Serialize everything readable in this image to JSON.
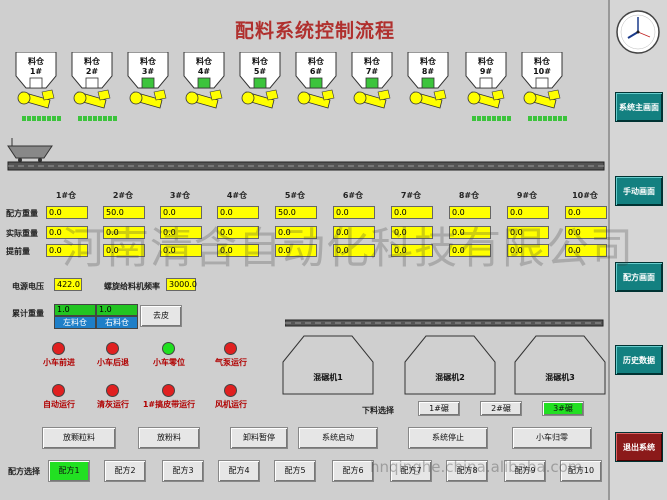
{
  "title": "配料系统控制流程",
  "hoppers": [
    {
      "line1": "料仓",
      "line2": "1#"
    },
    {
      "line1": "料仓",
      "line2": "2#"
    },
    {
      "line1": "料仓",
      "line2": "3#"
    },
    {
      "line1": "料仓",
      "line2": "4#"
    },
    {
      "line1": "料仓",
      "line2": "5#"
    },
    {
      "line1": "料仓",
      "line2": "6#"
    },
    {
      "line1": "料仓",
      "line2": "7#"
    },
    {
      "line1": "料仓",
      "line2": "8#"
    },
    {
      "line1": "料仓",
      "line2": "9#"
    },
    {
      "line1": "料仓",
      "line2": "10#"
    }
  ],
  "table": {
    "columns": [
      "1#仓",
      "2#仓",
      "3#仓",
      "4#仓",
      "5#仓",
      "6#仓",
      "7#仓",
      "8#仓",
      "9#仓",
      "10#仓"
    ],
    "rows": [
      {
        "label": "配方重量",
        "values": [
          "0.0",
          "50.0",
          "0.0",
          "0.0",
          "50.0",
          "0.0",
          "0.0",
          "0.0",
          "0.0",
          "0.0"
        ]
      },
      {
        "label": "实际重量",
        "values": [
          "0.0",
          "0.0",
          "0.0",
          "0.0",
          "0.0",
          "0.0",
          "0.0",
          "0.0",
          "0.0",
          "0.0"
        ]
      },
      {
        "label": "提前量",
        "values": [
          "0.0",
          "0.0",
          "0.0",
          "0.0",
          "0.0",
          "0.0",
          "0.0",
          "0.0",
          "0.0",
          "0.0"
        ]
      }
    ]
  },
  "voltage": {
    "label": "电源电压",
    "value": "422.0"
  },
  "screw_freq": {
    "label": "螺旋给料机频率",
    "value": "3000.0"
  },
  "cumulative": {
    "label": "累计重量",
    "left_value": "1.0",
    "right_value": "1.0",
    "left_label": "左料仓",
    "right_label": "右料仓"
  },
  "remove_tare": "去皮",
  "lamps_row1": [
    {
      "label": "小车前进",
      "color": "#e02020"
    },
    {
      "label": "小车后退",
      "color": "#e02020"
    },
    {
      "label": "小车零位",
      "color": "#20e020"
    },
    {
      "label": "气泵运行",
      "color": "#e02020"
    }
  ],
  "lamps_row2": [
    {
      "label": "自动运行",
      "color": "#e02020"
    },
    {
      "label": "清灰运行",
      "color": "#e02020"
    },
    {
      "label": "1#搞皮带运行",
      "color": "#e02020"
    },
    {
      "label": "风机运行",
      "color": "#e02020"
    }
  ],
  "mixers": [
    "混碾机1",
    "混碾机2",
    "混碾机3"
  ],
  "discharge": {
    "label": "下料选择",
    "options": [
      "1#碾",
      "2#碾",
      "3#碾"
    ],
    "active_index": 2
  },
  "actions": [
    "放颗粒料",
    "放粉料",
    "卸料暂停",
    "系统启动",
    "系统停止",
    "小车归零"
  ],
  "recipe": {
    "label": "配方选择",
    "options": [
      "配方1",
      "配方2",
      "配方3",
      "配方4",
      "配方5",
      "配方6",
      "配方7",
      "配方8",
      "配方9",
      "配方10"
    ],
    "active_index": 0
  },
  "sidebar": {
    "buttons": [
      "系统主画面",
      "手动画面",
      "配方画面",
      "历史数据"
    ],
    "exit": "退出系统"
  },
  "watermark": {
    "text": "河南清含自动化科技有限公司",
    "url": "hnqinghe.china.alibaba.com"
  },
  "colors": {
    "accent": "#138080",
    "exit": "#8b1a1a",
    "title": "#b0302e",
    "field": "#ffff00",
    "cumulative": "#1e7fc8"
  }
}
